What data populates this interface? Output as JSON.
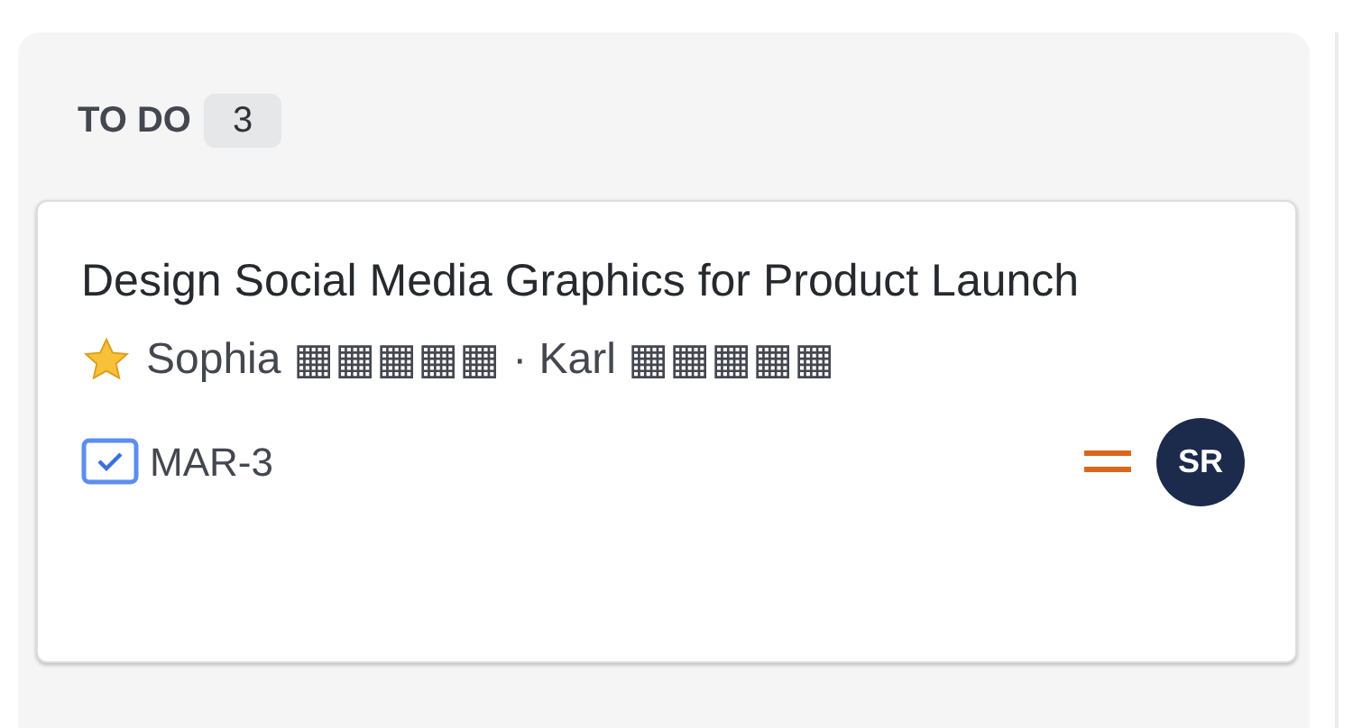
{
  "column": {
    "title": "TO DO",
    "count": "3"
  },
  "card": {
    "title": "Design Social Media Graphics for Product Launch",
    "reviewers": "Sophia ▦▦▦▦▦ · Karl ▦▦▦▦▦",
    "key": "MAR-3",
    "assignee_initials": "SR"
  }
}
